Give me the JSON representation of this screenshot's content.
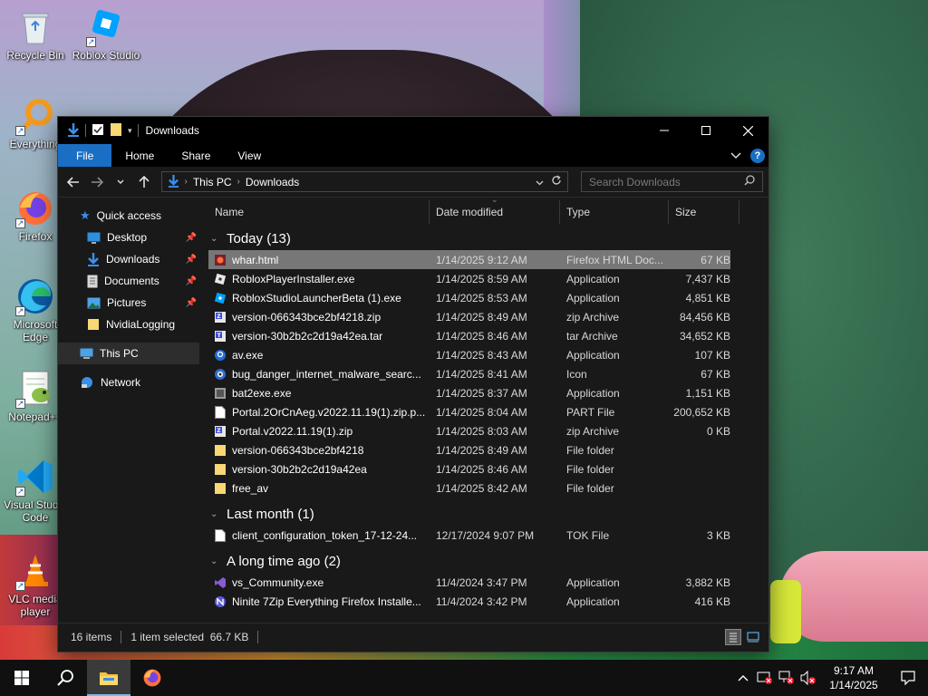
{
  "desktop": {
    "icons": [
      {
        "label": "Recycle Bin"
      },
      {
        "label": "Roblox Studio"
      },
      {
        "label": "Everything"
      },
      {
        "label": "Firefox"
      },
      {
        "label": "Microsoft Edge"
      },
      {
        "label": "Notepad++"
      },
      {
        "label": "Visual Studio Code"
      },
      {
        "label": "VLC media player"
      }
    ]
  },
  "window": {
    "title": "Downloads",
    "ribbon_tabs": [
      "File",
      "Home",
      "Share",
      "View"
    ],
    "address": {
      "segments": [
        "This PC",
        "Downloads"
      ]
    },
    "search": {
      "placeholder": "Search Downloads"
    }
  },
  "navpane": {
    "quick_access": "Quick access",
    "pinned": [
      {
        "label": "Desktop",
        "icon": "desktop-icon"
      },
      {
        "label": "Downloads",
        "icon": "download-arrow-icon"
      },
      {
        "label": "Documents",
        "icon": "documents-icon"
      },
      {
        "label": "Pictures",
        "icon": "pictures-icon"
      },
      {
        "label": "NvidiaLogging",
        "icon": "folder-icon"
      }
    ],
    "this_pc": "This PC",
    "network": "Network"
  },
  "columns": {
    "name": "Name",
    "date": "Date modified",
    "type": "Type",
    "size": "Size"
  },
  "groups": [
    {
      "title": "Today (13)",
      "files": [
        {
          "name": "whar.html",
          "date": "1/14/2025 9:12 AM",
          "type": "Firefox HTML Doc...",
          "size": "67 KB",
          "icon": "html-icon",
          "selected": true
        },
        {
          "name": "RobloxPlayerInstaller.exe",
          "date": "1/14/2025 8:59 AM",
          "type": "Application",
          "size": "7,437 KB",
          "icon": "roblox-player-icon"
        },
        {
          "name": "RobloxStudioLauncherBeta (1).exe",
          "date": "1/14/2025 8:53 AM",
          "type": "Application",
          "size": "4,851 KB",
          "icon": "roblox-studio-icon"
        },
        {
          "name": "version-066343bce2bf4218.zip",
          "date": "1/14/2025 8:49 AM",
          "type": "zip Archive",
          "size": "84,456 KB",
          "icon": "zip-icon"
        },
        {
          "name": "version-30b2b2c2d19a42ea.tar",
          "date": "1/14/2025 8:46 AM",
          "type": "tar Archive",
          "size": "34,652 KB",
          "icon": "tar-icon"
        },
        {
          "name": "av.exe",
          "date": "1/14/2025 8:43 AM",
          "type": "Application",
          "size": "107 KB",
          "icon": "app-magnifier-icon"
        },
        {
          "name": "bug_danger_internet_malware_searc...",
          "date": "1/14/2025 8:41 AM",
          "type": "Icon",
          "size": "67 KB",
          "icon": "ico-file-icon"
        },
        {
          "name": "bat2exe.exe",
          "date": "1/14/2025 8:37 AM",
          "type": "Application",
          "size": "1,151 KB",
          "icon": "bat2exe-icon"
        },
        {
          "name": "Portal.2OrCnAeg.v2022.11.19(1).zip.p...",
          "date": "1/14/2025 8:04 AM",
          "type": "PART File",
          "size": "200,652 KB",
          "icon": "blank-file-icon"
        },
        {
          "name": "Portal.v2022.11.19(1).zip",
          "date": "1/14/2025 8:03 AM",
          "type": "zip Archive",
          "size": "0 KB",
          "icon": "zip-icon"
        },
        {
          "name": "version-066343bce2bf4218",
          "date": "1/14/2025 8:49 AM",
          "type": "File folder",
          "size": "",
          "icon": "folder-icon"
        },
        {
          "name": "version-30b2b2c2d19a42ea",
          "date": "1/14/2025 8:46 AM",
          "type": "File folder",
          "size": "",
          "icon": "folder-icon"
        },
        {
          "name": "free_av",
          "date": "1/14/2025 8:42 AM",
          "type": "File folder",
          "size": "",
          "icon": "folder-icon"
        }
      ]
    },
    {
      "title": "Last month (1)",
      "files": [
        {
          "name": "client_configuration_token_17-12-24...",
          "date": "12/17/2024 9:07 PM",
          "type": "TOK File",
          "size": "3 KB",
          "icon": "blank-file-icon"
        }
      ]
    },
    {
      "title": "A long time ago (2)",
      "files": [
        {
          "name": "vs_Community.exe",
          "date": "11/4/2024 3:47 PM",
          "type": "Application",
          "size": "3,882 KB",
          "icon": "visual-studio-icon"
        },
        {
          "name": "Ninite 7Zip Everything Firefox Installe...",
          "date": "11/4/2024 3:42 PM",
          "type": "Application",
          "size": "416 KB",
          "icon": "ninite-icon"
        }
      ]
    }
  ],
  "status": {
    "items": "16 items",
    "selected": "1 item selected  66.7 KB"
  },
  "taskbar": {
    "time": "9:17 AM",
    "date": "1/14/2025"
  },
  "colors": {
    "accent": "#1a6fc4",
    "folder": "#f8d775",
    "selection": "#777777"
  }
}
